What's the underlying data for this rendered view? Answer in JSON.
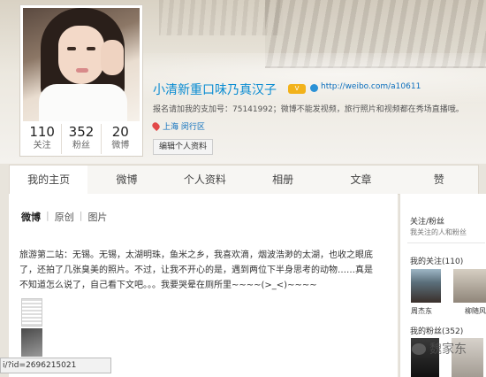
{
  "profile": {
    "name": "小清新重口味乃真汉子",
    "vip_badge": "V",
    "url": "http://weibo.com/a10611",
    "description": "报名请加我的支加号：75141992；微博不能发视频，旅行照片和视频都在秀场直播哦。",
    "location": "上海 闵行区",
    "edit_button": "编辑个人资料",
    "stats": [
      {
        "num": "110",
        "label": "关注"
      },
      {
        "num": "352",
        "label": "粉丝"
      },
      {
        "num": "20",
        "label": "微博"
      }
    ]
  },
  "tabs": [
    "我的主页",
    "微博",
    "个人资料",
    "相册",
    "文章",
    "赞"
  ],
  "subtabs": {
    "weibo": "微博",
    "original": "原创",
    "photo": "图片",
    "sep": "|"
  },
  "post": {
    "text": "旅游第二站：无锡。无锡，太湖明珠，鱼米之乡，我喜欢滴，烟波浩渺的太湖，也收之眼底了，还拍了几张臭美的照片。不过，让我不开心的是，遇到两位下半身思考的动物……真是不知道怎么说了，自己看下文吧。。。我要哭晕在厕所里~~~~(>_<)~~~~"
  },
  "status_url": "i/?id=2696215021",
  "sidebar": {
    "title": "关注/粉丝",
    "subtitle": "我关注的人和粉丝",
    "following": "我的关注(110)",
    "following_names": [
      "周杰东",
      "柳随风"
    ],
    "fans": "我的粉丝(352)"
  },
  "watermark": "魏家东",
  "colors": {
    "link": "#0a8cd2",
    "badge": "#f2b21a"
  }
}
